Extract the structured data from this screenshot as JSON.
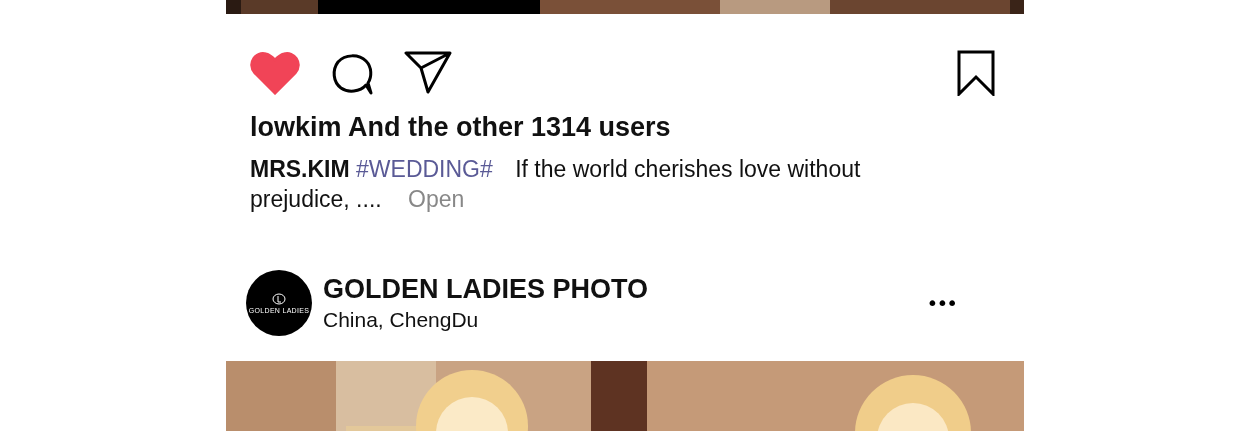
{
  "top_post": {
    "liked": true,
    "saved": false,
    "likes": "lowkim And the other 1314 users",
    "caption": {
      "author": "MRS.KIM",
      "tag": "#WEDDING#",
      "text": "If the world cherishes love without prejudice, ....",
      "more": "Open"
    }
  },
  "next_post": {
    "avatar_text": "GOLDEN LADIES",
    "name": "GOLDEN LADIES PHOTO",
    "location": "China,  ChengDu",
    "more": "•••"
  }
}
